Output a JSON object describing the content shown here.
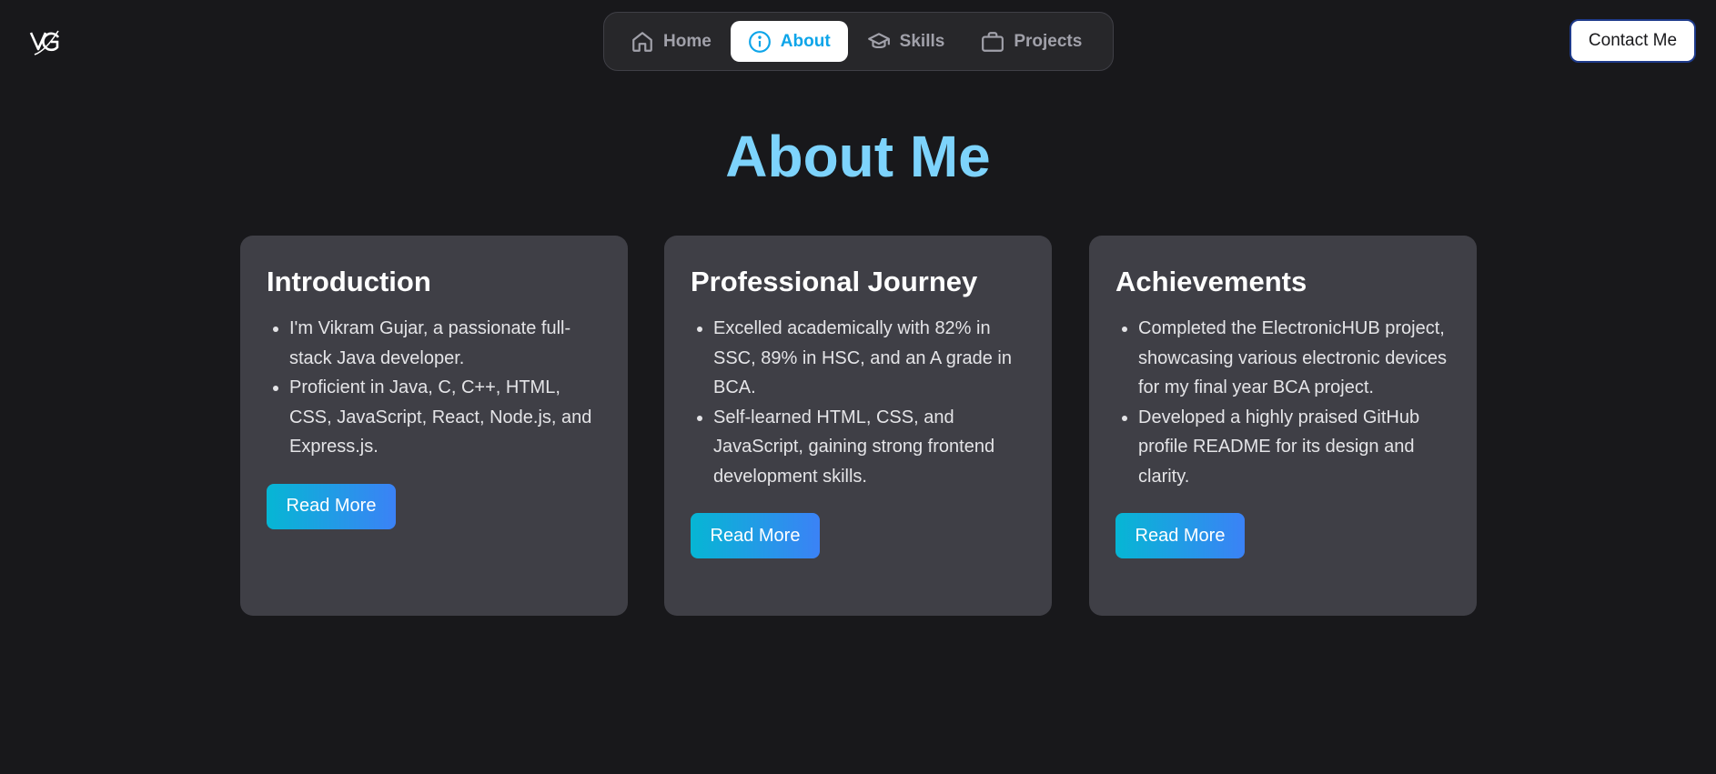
{
  "logo": {
    "text": "VG",
    "icon": "vg-logo-icon"
  },
  "nav": {
    "items": [
      {
        "label": "Home",
        "icon": "home-icon",
        "active": false
      },
      {
        "label": "About",
        "icon": "info-icon",
        "active": true
      },
      {
        "label": "Skills",
        "icon": "graduation-cap-icon",
        "active": false
      },
      {
        "label": "Projects",
        "icon": "briefcase-icon",
        "active": false
      }
    ]
  },
  "header": {
    "contact_label": "Contact Me"
  },
  "page": {
    "title": "About Me"
  },
  "cards": [
    {
      "title": "Introduction",
      "items": [
        "I'm Vikram Gujar, a passionate full-stack Java developer.",
        "Proficient in Java, C, C++, HTML, CSS, JavaScript, React, Node.js, and Express.js."
      ],
      "button": "Read More"
    },
    {
      "title": "Professional Journey",
      "items": [
        "Excelled academically with 82% in SSC, 89% in HSC, and an A grade in BCA.",
        "Self-learned HTML, CSS, and JavaScript, gaining strong frontend development skills."
      ],
      "button": "Read More"
    },
    {
      "title": "Achievements",
      "items": [
        "Completed the ElectronicHUB project, showcasing various electronic devices for my final year BCA project.",
        "Developed a highly praised GitHub profile README for its design and clarity."
      ],
      "button": "Read More"
    }
  ],
  "colors": {
    "background": "#18181b",
    "card": "#3f3f46",
    "accent": "#7dd3fc",
    "active_nav_text": "#0ea5e9",
    "button_gradient_start": "#06b6d4",
    "button_gradient_end": "#3b82f6"
  }
}
